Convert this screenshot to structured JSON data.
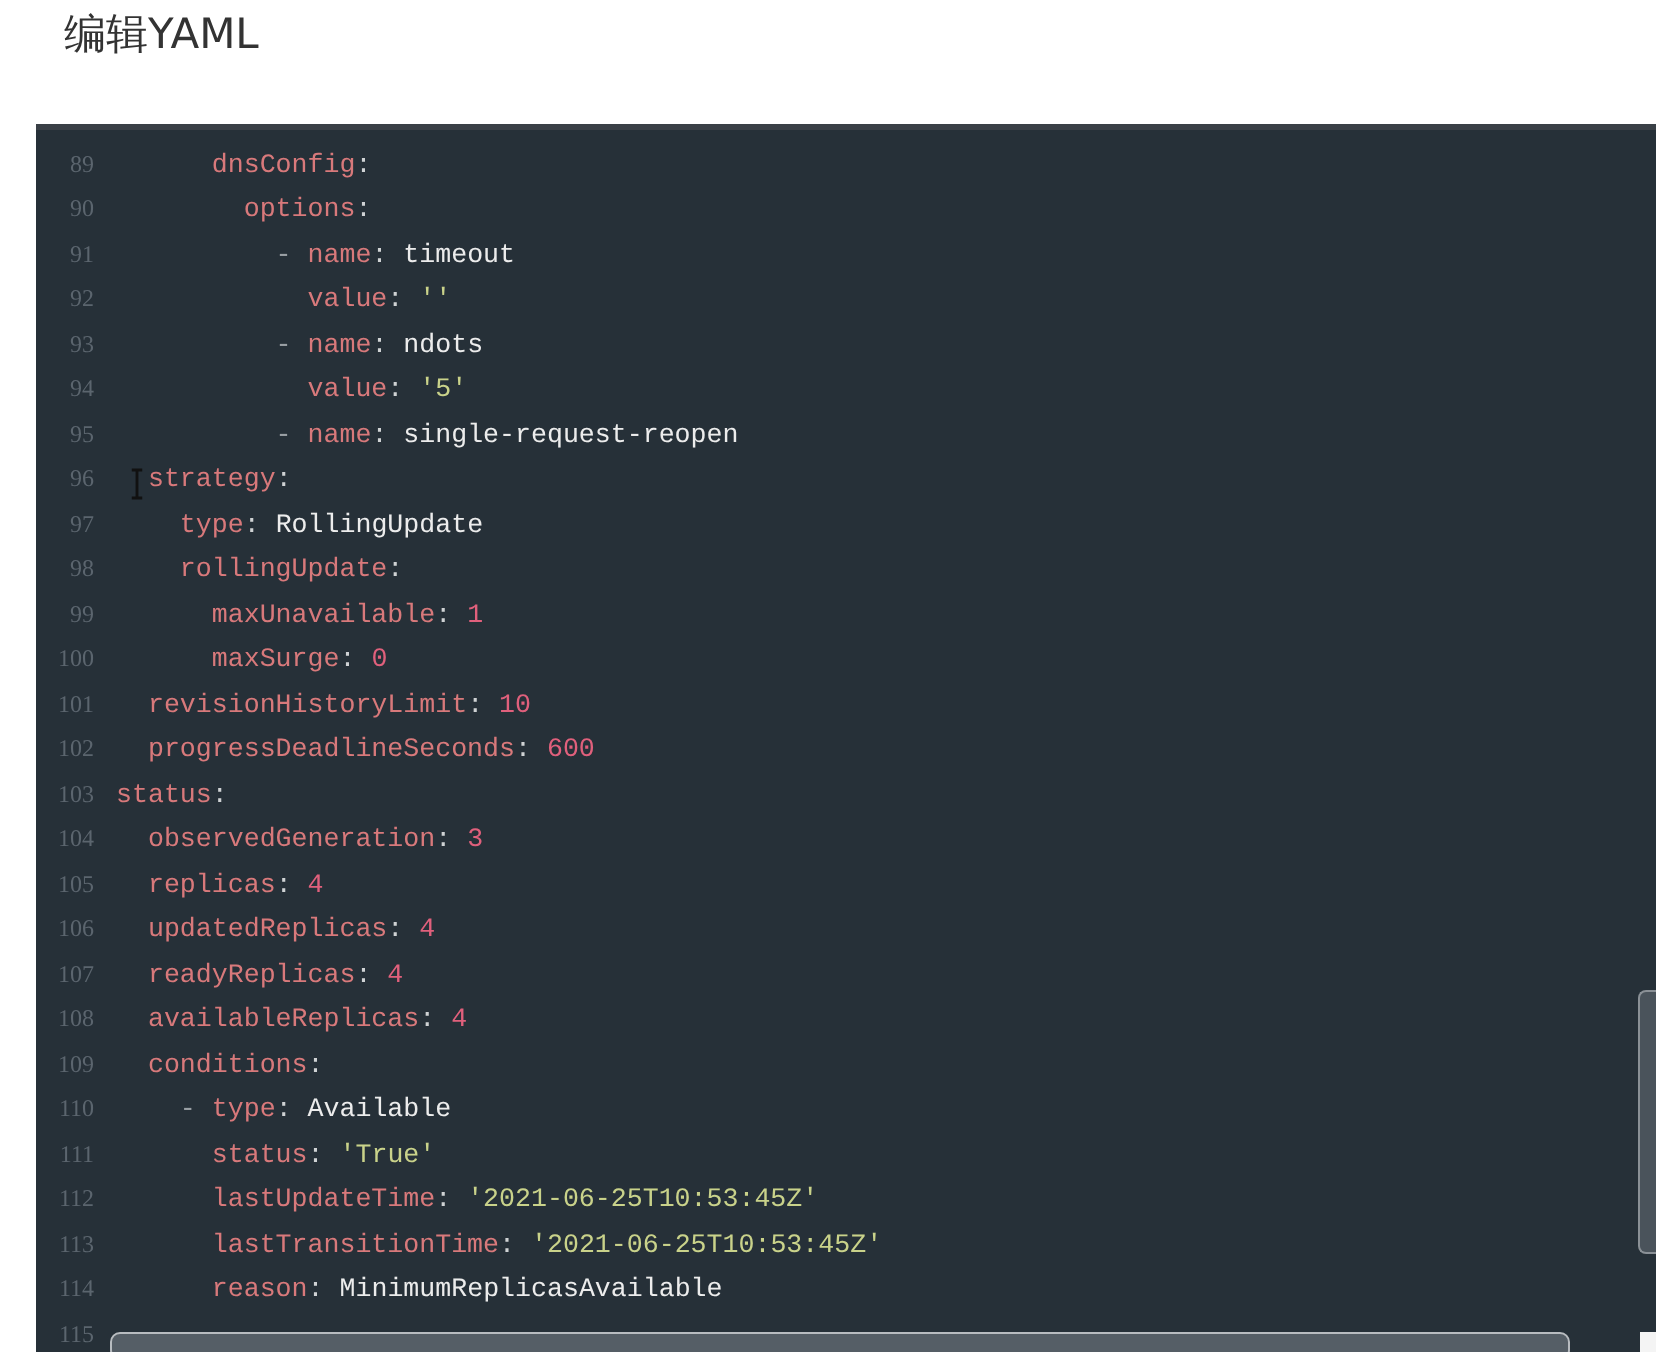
{
  "title": "编辑YAML",
  "editor": {
    "lines": [
      {
        "number": "89",
        "tokens": [
          {
            "kind": "key",
            "text": "      dnsConfig"
          },
          {
            "kind": "punct",
            "text": ":"
          }
        ]
      },
      {
        "number": "90",
        "tokens": [
          {
            "kind": "key",
            "text": "        options"
          },
          {
            "kind": "punct",
            "text": ":"
          }
        ]
      },
      {
        "number": "91",
        "tokens": [
          {
            "kind": "dash",
            "text": "          - "
          },
          {
            "kind": "key",
            "text": "name"
          },
          {
            "kind": "punct",
            "text": ": "
          },
          {
            "kind": "value",
            "text": "timeout"
          }
        ]
      },
      {
        "number": "92",
        "tokens": [
          {
            "kind": "key",
            "text": "            value"
          },
          {
            "kind": "punct",
            "text": ": "
          },
          {
            "kind": "string",
            "text": "''"
          }
        ]
      },
      {
        "number": "93",
        "tokens": [
          {
            "kind": "dash",
            "text": "          - "
          },
          {
            "kind": "key",
            "text": "name"
          },
          {
            "kind": "punct",
            "text": ": "
          },
          {
            "kind": "value",
            "text": "ndots"
          }
        ]
      },
      {
        "number": "94",
        "tokens": [
          {
            "kind": "key",
            "text": "            value"
          },
          {
            "kind": "punct",
            "text": ": "
          },
          {
            "kind": "string",
            "text": "'5'"
          }
        ]
      },
      {
        "number": "95",
        "tokens": [
          {
            "kind": "dash",
            "text": "          - "
          },
          {
            "kind": "key",
            "text": "name"
          },
          {
            "kind": "punct",
            "text": ": "
          },
          {
            "kind": "value",
            "text": "single-request-reopen"
          }
        ]
      },
      {
        "number": "96",
        "tokens": [
          {
            "kind": "key",
            "text": "  strategy"
          },
          {
            "kind": "punct",
            "text": ":"
          }
        ]
      },
      {
        "number": "97",
        "tokens": [
          {
            "kind": "key",
            "text": "    type"
          },
          {
            "kind": "punct",
            "text": ": "
          },
          {
            "kind": "value",
            "text": "RollingUpdate"
          }
        ]
      },
      {
        "number": "98",
        "tokens": [
          {
            "kind": "key",
            "text": "    rollingUpdate"
          },
          {
            "kind": "punct",
            "text": ":"
          }
        ]
      },
      {
        "number": "99",
        "tokens": [
          {
            "kind": "key",
            "text": "      maxUnavailable"
          },
          {
            "kind": "punct",
            "text": ": "
          },
          {
            "kind": "number",
            "text": "1"
          }
        ]
      },
      {
        "number": "100",
        "tokens": [
          {
            "kind": "key",
            "text": "      maxSurge"
          },
          {
            "kind": "punct",
            "text": ": "
          },
          {
            "kind": "number",
            "text": "0"
          }
        ]
      },
      {
        "number": "101",
        "tokens": [
          {
            "kind": "key",
            "text": "  revisionHistoryLimit"
          },
          {
            "kind": "punct",
            "text": ": "
          },
          {
            "kind": "number",
            "text": "10"
          }
        ]
      },
      {
        "number": "102",
        "tokens": [
          {
            "kind": "key",
            "text": "  progressDeadlineSeconds"
          },
          {
            "kind": "punct",
            "text": ": "
          },
          {
            "kind": "number",
            "text": "600"
          }
        ]
      },
      {
        "number": "103",
        "tokens": [
          {
            "kind": "key",
            "text": "status"
          },
          {
            "kind": "punct",
            "text": ":"
          }
        ]
      },
      {
        "number": "104",
        "tokens": [
          {
            "kind": "key",
            "text": "  observedGeneration"
          },
          {
            "kind": "punct",
            "text": ": "
          },
          {
            "kind": "number",
            "text": "3"
          }
        ]
      },
      {
        "number": "105",
        "tokens": [
          {
            "kind": "key",
            "text": "  replicas"
          },
          {
            "kind": "punct",
            "text": ": "
          },
          {
            "kind": "number",
            "text": "4"
          }
        ]
      },
      {
        "number": "106",
        "tokens": [
          {
            "kind": "key",
            "text": "  updatedReplicas"
          },
          {
            "kind": "punct",
            "text": ": "
          },
          {
            "kind": "number",
            "text": "4"
          }
        ]
      },
      {
        "number": "107",
        "tokens": [
          {
            "kind": "key",
            "text": "  readyReplicas"
          },
          {
            "kind": "punct",
            "text": ": "
          },
          {
            "kind": "number",
            "text": "4"
          }
        ]
      },
      {
        "number": "108",
        "tokens": [
          {
            "kind": "key",
            "text": "  availableReplicas"
          },
          {
            "kind": "punct",
            "text": ": "
          },
          {
            "kind": "number",
            "text": "4"
          }
        ]
      },
      {
        "number": "109",
        "tokens": [
          {
            "kind": "key",
            "text": "  conditions"
          },
          {
            "kind": "punct",
            "text": ":"
          }
        ]
      },
      {
        "number": "110",
        "tokens": [
          {
            "kind": "dash",
            "text": "    - "
          },
          {
            "kind": "key",
            "text": "type"
          },
          {
            "kind": "punct",
            "text": ": "
          },
          {
            "kind": "value",
            "text": "Available"
          }
        ]
      },
      {
        "number": "111",
        "tokens": [
          {
            "kind": "key",
            "text": "      status"
          },
          {
            "kind": "punct",
            "text": ": "
          },
          {
            "kind": "string",
            "text": "'True'"
          }
        ]
      },
      {
        "number": "112",
        "tokens": [
          {
            "kind": "key",
            "text": "      lastUpdateTime"
          },
          {
            "kind": "punct",
            "text": ": "
          },
          {
            "kind": "string",
            "text": "'2021-06-25T10:53:45Z'"
          }
        ]
      },
      {
        "number": "113",
        "tokens": [
          {
            "kind": "key",
            "text": "      lastTransitionTime"
          },
          {
            "kind": "punct",
            "text": ": "
          },
          {
            "kind": "string",
            "text": "'2021-06-25T10:53:45Z'"
          }
        ]
      },
      {
        "number": "114",
        "tokens": [
          {
            "kind": "key",
            "text": "      reason"
          },
          {
            "kind": "punct",
            "text": ": "
          },
          {
            "kind": "value",
            "text": "MinimumReplicasAvailable"
          }
        ]
      },
      {
        "number": "115"
      }
    ]
  }
}
